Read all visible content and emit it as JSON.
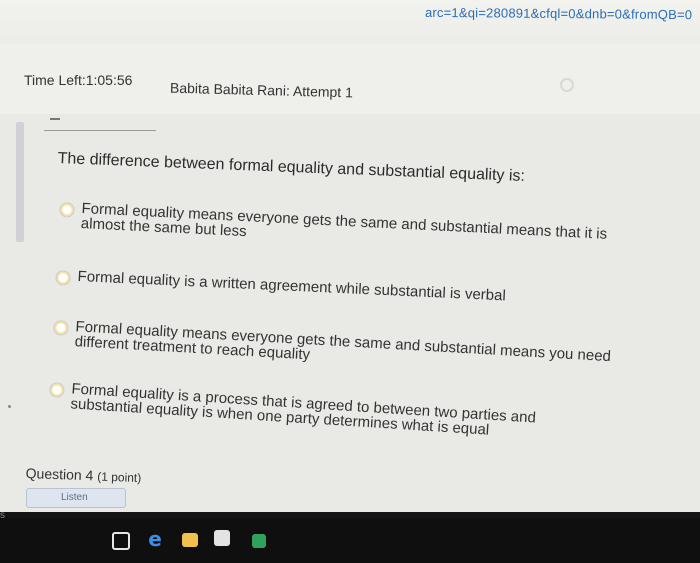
{
  "browser": {
    "url_fragment": "arc=1&qi=280891&cfql=0&dnb=0&fromQB=0"
  },
  "header": {
    "time_left": "Time Left:1:05:56",
    "attempt_title": "Babita Babita Rani: Attempt 1"
  },
  "question": {
    "text": "The difference between formal equality and substantial equality is:",
    "options": [
      {
        "lines": [
          "Formal equality means everyone gets the same and substantial means that it is",
          "almost the same but less"
        ]
      },
      {
        "lines": [
          "Formal equality is a written agreement while substantial is verbal"
        ]
      },
      {
        "lines": [
          "Formal equality means everyone gets the same and substantial means you need",
          "different treatment to reach equality"
        ]
      },
      {
        "lines": [
          "Formal equality is a process that is agreed to between two parties and",
          "substantial equality is when one party determines what is equal"
        ]
      }
    ]
  },
  "next_question": {
    "label": "Question 4",
    "points": "(1 point)",
    "listen_label": "Listen"
  },
  "taskbar": {
    "icons": [
      "task-view-icon",
      "edge-icon",
      "file-explorer-icon",
      "store-icon",
      "excel-icon"
    ]
  },
  "colors": {
    "url": "#2a6db8",
    "background": "#e9e9e6",
    "taskbar": "#0f0f10"
  }
}
